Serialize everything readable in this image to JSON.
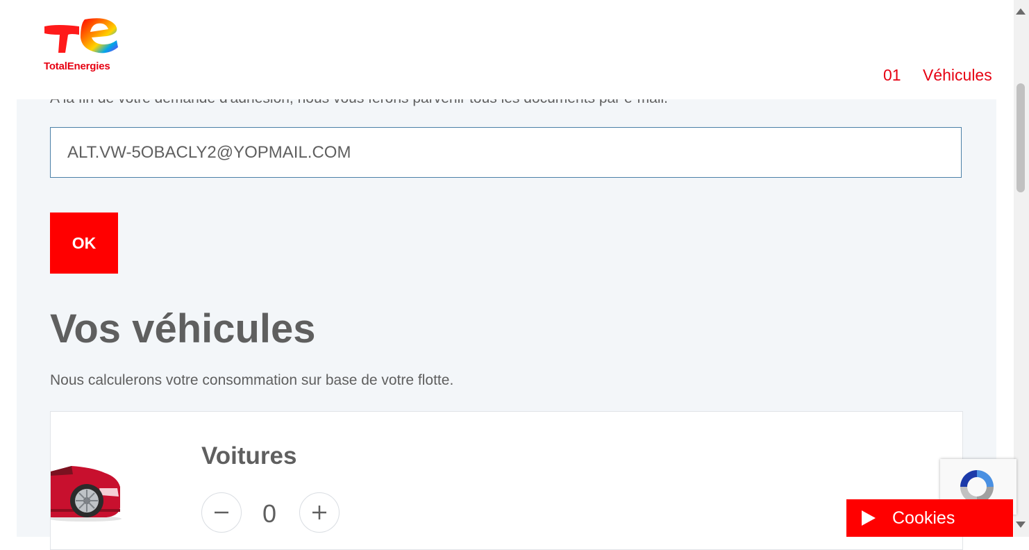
{
  "header": {
    "logo_text": "TotalEnergies",
    "step_number": "01",
    "step_label": "Véhicules"
  },
  "form": {
    "intro_text": "A la fin de votre demande d'adhésion, nous vous ferons parvenir tous les documents par e-mail.",
    "email_value": "ALT.VW-5OBACLY2@YOPMAIL.COM",
    "ok_label": "OK"
  },
  "vehicles": {
    "title": "Vos véhicules",
    "subtitle": "Nous calculerons votre consommation sur base de votre flotte.",
    "cards": [
      {
        "label": "Voitures",
        "quantity": "0",
        "icon": "red-car-illustration"
      }
    ]
  },
  "cookies": {
    "label": "Cookies"
  },
  "colors": {
    "brand_red": "#ff0000",
    "panel_bg": "#f3f6f9",
    "text_gray": "#5f5f5f"
  },
  "icons": [
    "minus-icon",
    "plus-icon",
    "play-icon",
    "recaptcha-icon",
    "totalenergies-logo"
  ]
}
